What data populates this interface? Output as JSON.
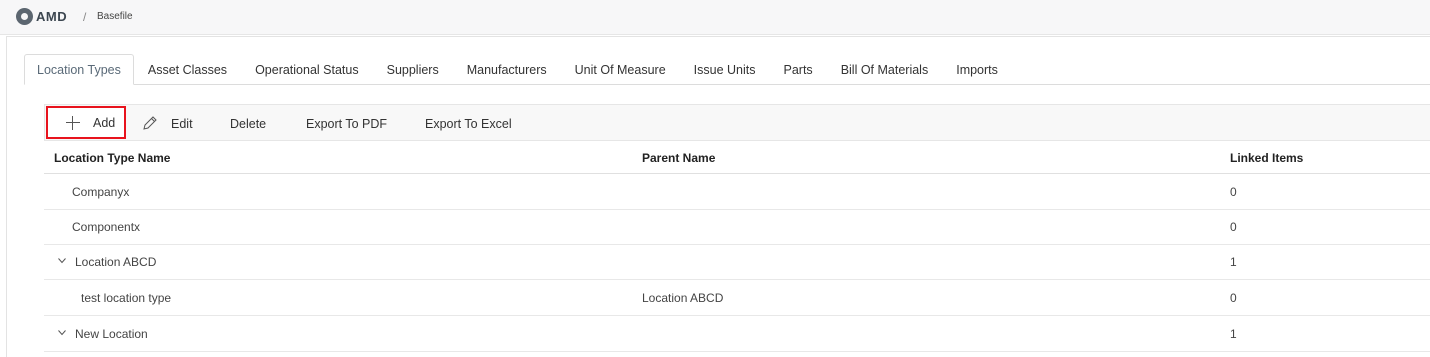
{
  "header": {
    "logo_text": "AMD",
    "breadcrumb_separator": "/",
    "breadcrumb": "Basefile"
  },
  "tabs": [
    {
      "label": "Location Types",
      "active": true
    },
    {
      "label": "Asset Classes"
    },
    {
      "label": "Operational Status"
    },
    {
      "label": "Suppliers"
    },
    {
      "label": "Manufacturers"
    },
    {
      "label": "Unit Of Measure"
    },
    {
      "label": "Issue Units"
    },
    {
      "label": "Parts"
    },
    {
      "label": "Bill Of Materials"
    },
    {
      "label": "Imports"
    }
  ],
  "toolbar": {
    "add_label": "Add",
    "edit_label": "Edit",
    "delete_label": "Delete",
    "export_pdf_label": "Export To PDF",
    "export_excel_label": "Export To Excel"
  },
  "grid": {
    "columns": [
      "Location Type Name",
      "Parent Name",
      "Linked Items"
    ],
    "rows": [
      {
        "name": "Companyx",
        "parent": "",
        "linked": "0",
        "expandable": false,
        "level": 0
      },
      {
        "name": "Componentx",
        "parent": "",
        "linked": "0",
        "expandable": false,
        "level": 0
      },
      {
        "name": "Location ABCD",
        "parent": "",
        "linked": "1",
        "expandable": true,
        "level": 0
      },
      {
        "name": "test location type",
        "parent": "Location ABCD",
        "linked": "0",
        "expandable": false,
        "level": 1
      },
      {
        "name": "New Location",
        "parent": "",
        "linked": "1",
        "expandable": true,
        "level": 0
      }
    ]
  },
  "colors": {
    "highlight_border": "#e8131d",
    "active_tab_text": "#5a6a78"
  }
}
